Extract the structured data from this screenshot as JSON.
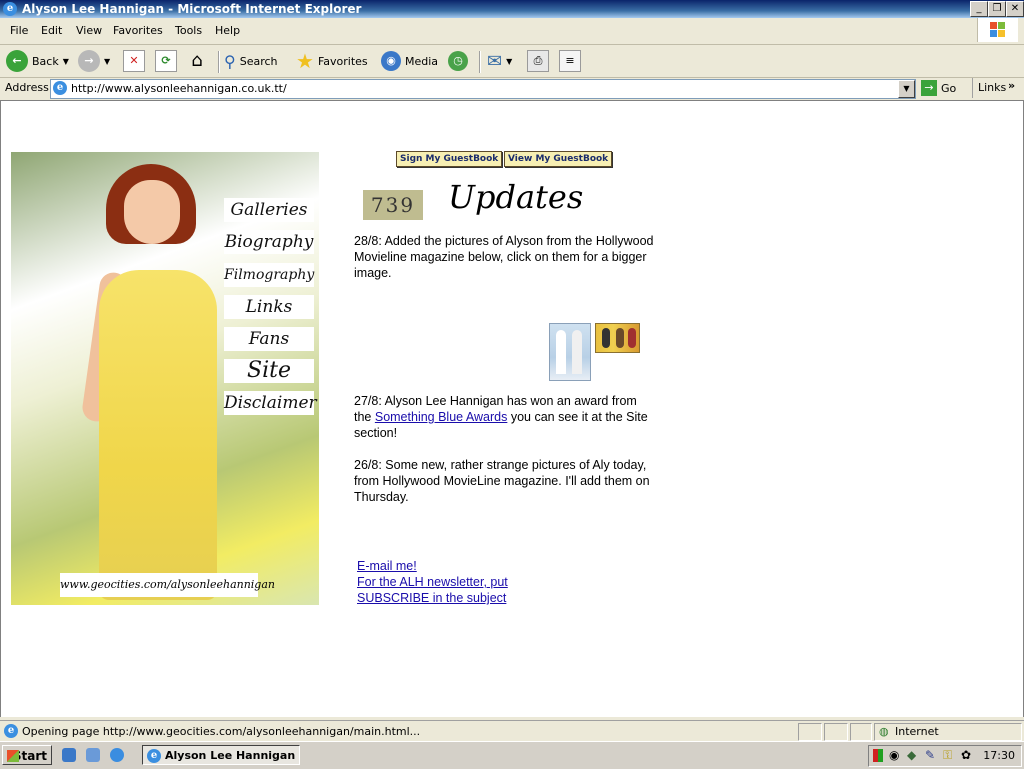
{
  "window": {
    "title": "Alyson Lee Hannigan - Microsoft Internet Explorer"
  },
  "menu": [
    "File",
    "Edit",
    "View",
    "Favorites",
    "Tools",
    "Help"
  ],
  "toolbar": {
    "back": "Back",
    "search": "Search",
    "favorites": "Favorites",
    "media": "Media"
  },
  "address": {
    "label": "Address",
    "url": "http://www.alysonleehannigan.co.uk.tt/",
    "go": "Go",
    "links": "Links"
  },
  "page": {
    "guestbook": {
      "sign": "Sign My GuestBook",
      "view": "View My GuestBook"
    },
    "counter": "739",
    "updates_heading": "Updates",
    "nav": [
      "Galleries",
      "Biography",
      "Filmography",
      "Links",
      "Fans",
      "Site",
      "Disclaimer"
    ],
    "banner_url": "www.geocities.com/alysonleehannigan",
    "update1": "28/8: Added the pictures of Alyson from the Hollywood Movieline magazine below, click on them for a bigger image.",
    "update2_prefix": "27/8: Alyson Lee Hannigan has won an award from the ",
    "update2_link": "Something Blue Awards",
    "update2_suffix": " you can see it at the Site section!",
    "update3": "26/8: Some new, rather strange pictures of Aly today, from Hollywood MovieLine magazine. I'll add them on Thursday.",
    "email": "E-mail me!",
    "newsletter1": "For the ALH newsletter, put",
    "newsletter2": "SUBSCRIBE in the subject"
  },
  "status": {
    "text": "Opening page http://www.geocities.com/alysonleehannigan/main.html...",
    "zone": "Internet"
  },
  "taskbar": {
    "start": "Start",
    "task": "Alyson Lee Hannigan ...",
    "clock": "17:30"
  }
}
